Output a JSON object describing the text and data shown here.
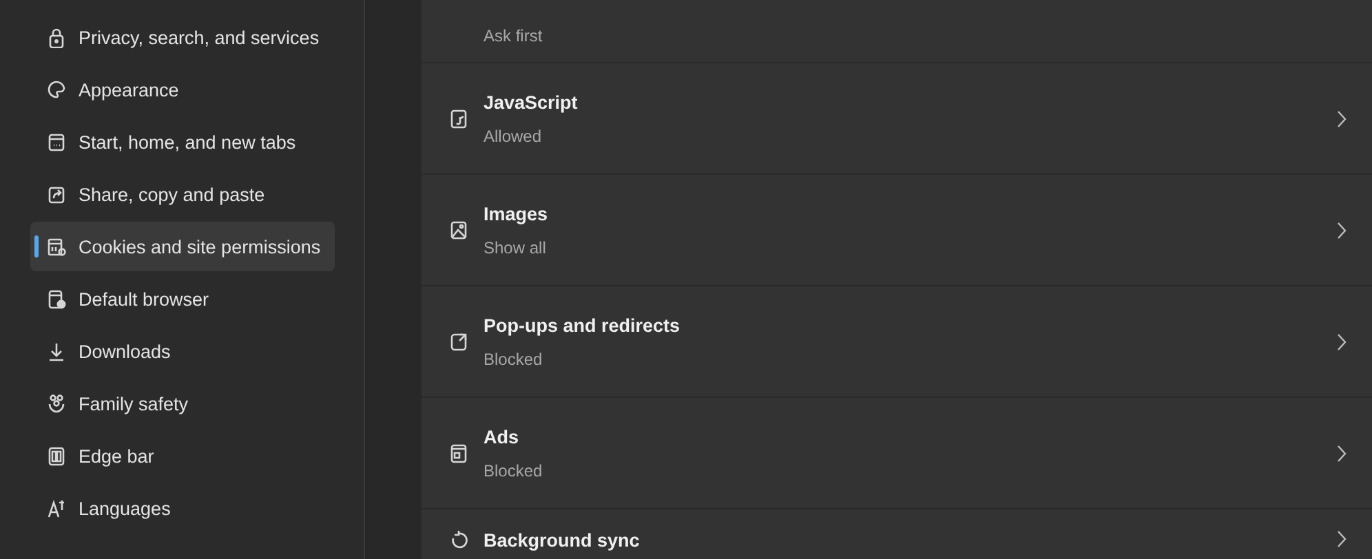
{
  "sidebar": {
    "items": [
      {
        "label": "Privacy, search, and services",
        "selected": false
      },
      {
        "label": "Appearance",
        "selected": false
      },
      {
        "label": "Start, home, and new tabs",
        "selected": false
      },
      {
        "label": "Share, copy and paste",
        "selected": false
      },
      {
        "label": "Cookies and site permissions",
        "selected": true
      },
      {
        "label": "Default browser",
        "selected": false
      },
      {
        "label": "Downloads",
        "selected": false
      },
      {
        "label": "Family safety",
        "selected": false
      },
      {
        "label": "Edge bar",
        "selected": false
      },
      {
        "label": "Languages",
        "selected": false
      }
    ]
  },
  "permissions": [
    {
      "subtitle": "Ask first"
    },
    {
      "title": "JavaScript",
      "subtitle": "Allowed"
    },
    {
      "title": "Images",
      "subtitle": "Show all"
    },
    {
      "title": "Pop-ups and redirects",
      "subtitle": "Blocked"
    },
    {
      "title": "Ads",
      "subtitle": "Blocked"
    },
    {
      "title": "Background sync"
    }
  ]
}
